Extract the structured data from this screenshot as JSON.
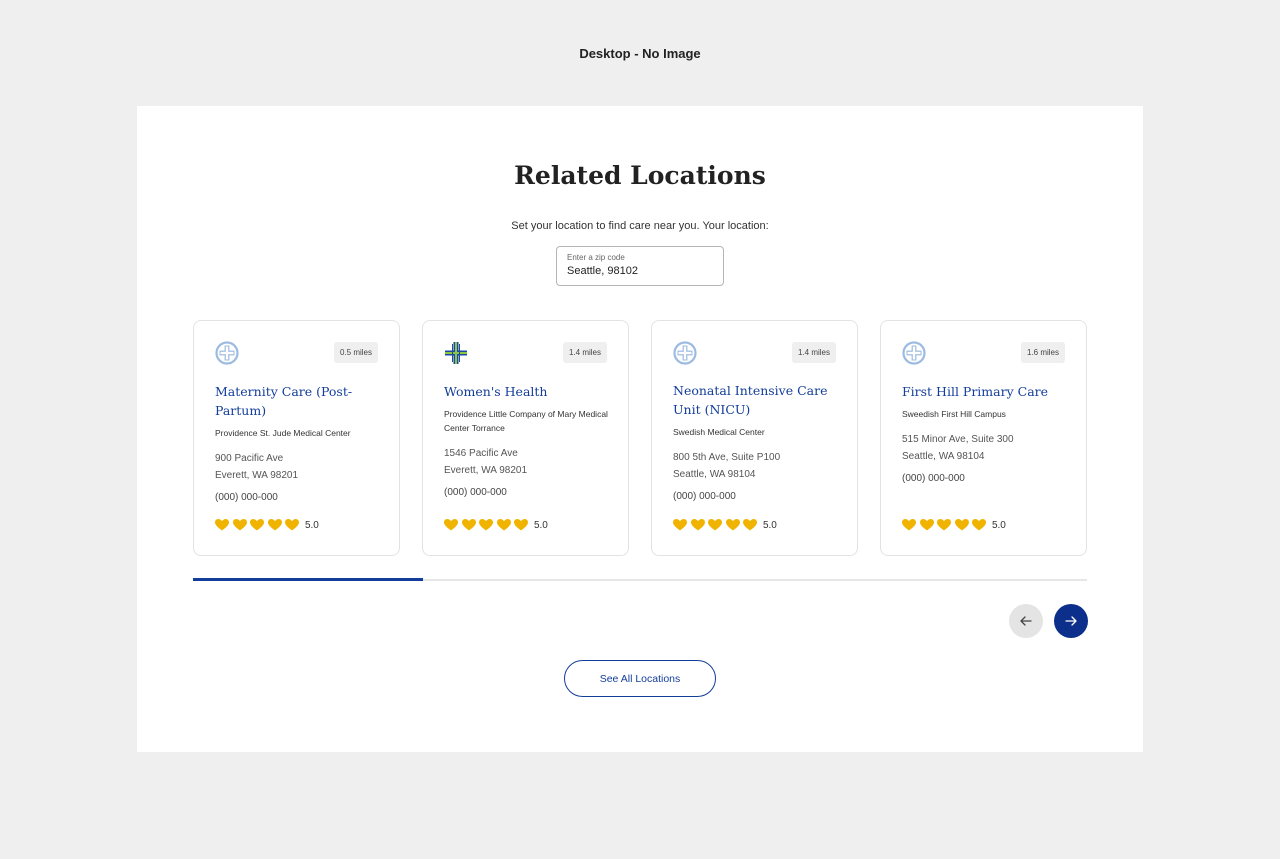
{
  "frame_label": "Desktop - No Image",
  "section": {
    "title": "Related Locations",
    "subtitle": "Set your location to find care near you. Your location:"
  },
  "zip": {
    "label": "Enter a zip code",
    "value": "Seattle, 98102"
  },
  "cards": [
    {
      "logo": "circle-cross-logo",
      "distance": "0.5 miles",
      "title": "Maternity Care (Post-Partum)",
      "facility": "Providence St. Jude Medical Center",
      "address_line1": "900 Pacific Ave",
      "address_line2": "Everett, WA 98201",
      "phone": "(000) 000-000",
      "rating": "5.0"
    },
    {
      "logo": "providence-cross-logo",
      "distance": "1.4 miles",
      "title": "Women's Health",
      "facility": "Providence Little Company of Mary Medical Center Torrance",
      "address_line1": "1546 Pacific Ave",
      "address_line2": "Everett, WA 98201",
      "phone": "(000) 000-000",
      "rating": "5.0"
    },
    {
      "logo": "circle-cross-logo",
      "distance": "1.4 miles",
      "title": "Neonatal Intensive Care Unit (NICU)",
      "facility": "Swedish Medical Center",
      "address_line1": "800 5th Ave, Suite P100",
      "address_line2": "Seattle, WA 98104",
      "phone": "(000) 000-000",
      "rating": "5.0"
    },
    {
      "logo": "circle-cross-logo",
      "distance": "1.6  miles",
      "title": "First Hill Primary Care",
      "facility": "Sweedish First Hill Campus",
      "address_line1": "515 Minor Ave, Suite 300",
      "address_line2": "Seattle, WA 98104",
      "phone": "(000) 000-000",
      "rating": "5.0"
    }
  ],
  "carousel": {
    "progress_fraction": 0.257,
    "prev_icon": "arrow-left-icon",
    "next_icon": "arrow-right-icon"
  },
  "see_all_label": "See All Locations",
  "colors": {
    "brand_blue": "#123d9a",
    "heart_gold": "#f0b400",
    "background": "#efefef"
  }
}
